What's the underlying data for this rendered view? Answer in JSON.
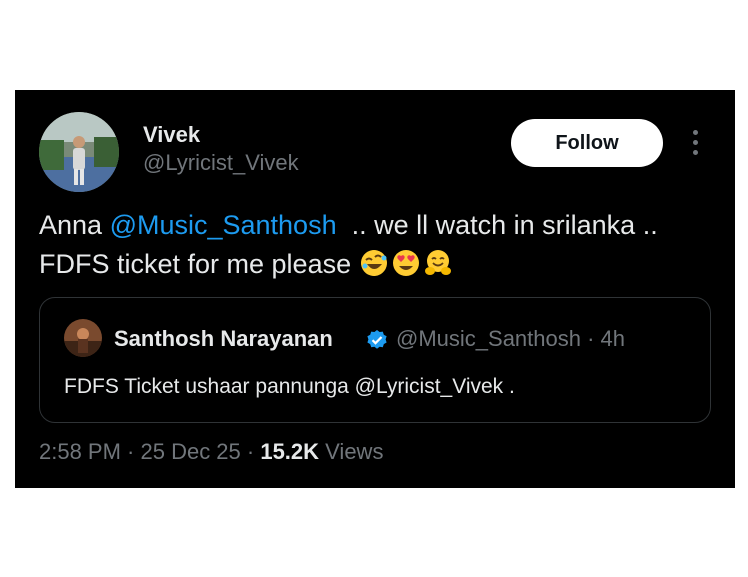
{
  "tweet": {
    "author_name": "Vivek",
    "author_handle": "@Lyricist_Vivek",
    "follow_label": "Follow",
    "more_icon": "more-vertical-icon",
    "text_prefix": "Anna ",
    "mention": "@Music_Santhosh",
    "text_line1_suffix": "  .. we ll watch in srilanka ..",
    "text_line2": "FDFS ticket for me please ",
    "emojis": [
      "rolling-on-floor-laughing",
      "heart-eyes",
      "hugging-face"
    ]
  },
  "quote": {
    "author_name": "Santhosh Narayanan",
    "verified_icon": "verified-badge-icon",
    "author_handle_time": "@Music_Santhosh · 4h",
    "text": "FDFS Ticket ushaar pannunga @Lyricist_Vivek ."
  },
  "meta": {
    "time_date": "2:58 PM · 25 Dec 25 · ",
    "views_count": "15.2K",
    "views_label": " Views"
  },
  "colors": {
    "background": "#000000",
    "text": "#e7e9ea",
    "secondary": "#71767b",
    "link": "#1d9bf0",
    "border": "#2f3336"
  }
}
